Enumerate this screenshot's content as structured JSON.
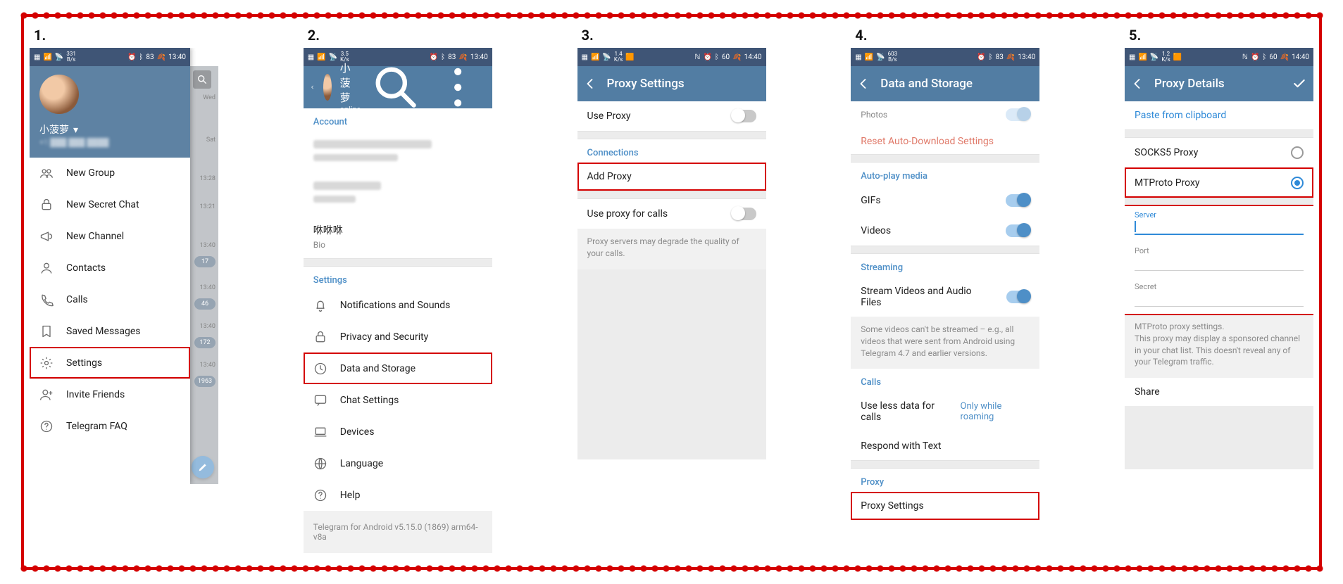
{
  "steps": {
    "s1": "1.",
    "s2": "2.",
    "s3": "3.",
    "s4": "4.",
    "s5": "5."
  },
  "step1": {
    "status": {
      "kbs": "331",
      "kbs_unit": "B/s",
      "battery": "83",
      "time": "13:40"
    },
    "drawer": {
      "username": "小菠萝",
      "items": {
        "new_group": "New Group",
        "new_secret_chat": "New Secret Chat",
        "new_channel": "New Channel",
        "contacts": "Contacts",
        "calls": "Calls",
        "saved_messages": "Saved Messages",
        "settings": "Settings",
        "invite_friends": "Invite Friends",
        "telegram_faq": "Telegram FAQ"
      }
    },
    "behind": {
      "day1": "Wed",
      "day2": "Sat",
      "t1": "13:28",
      "t2": "13:21",
      "t3": "13:40",
      "b1": "17",
      "t4": "13:40",
      "b2": "46",
      "t5": "13:40",
      "b3": "172",
      "t6": "13:40",
      "b4": "1963"
    }
  },
  "step2": {
    "status": {
      "kbs": "3.5",
      "kbs_unit": "K/s",
      "battery": "83",
      "time": "13:40"
    },
    "profile": {
      "name": "小菠萝",
      "status": "online"
    },
    "section_account": "Account",
    "bio_name": "咻咻咻",
    "bio_label": "Bio",
    "section_settings": "Settings",
    "items": {
      "notifications": "Notifications and Sounds",
      "privacy": "Privacy and Security",
      "data_storage": "Data and Storage",
      "chat_settings": "Chat Settings",
      "devices": "Devices",
      "language": "Language",
      "help": "Help"
    },
    "footer": "Telegram for Android v5.15.0 (1869) arm64-v8a"
  },
  "step3": {
    "status": {
      "kbs": "1.4",
      "kbs_unit": "K/s",
      "battery": "60",
      "time": "14:40"
    },
    "title": "Proxy Settings",
    "rows": {
      "use_proxy": "Use Proxy",
      "connections": "Connections",
      "add_proxy": "Add Proxy",
      "use_proxy_calls": "Use proxy for calls",
      "hint": "Proxy servers may degrade the quality of your calls."
    }
  },
  "step4": {
    "status": {
      "kbs": "603",
      "kbs_unit": "B/s",
      "battery": "83",
      "time": "13:40"
    },
    "title": "Data and Storage",
    "rows": {
      "photos": "Photos",
      "reset": "Reset Auto-Download Settings",
      "autoplay": "Auto-play media",
      "gifs": "GIFs",
      "videos": "Videos",
      "streaming": "Streaming",
      "stream_va": "Stream Videos and Audio Files",
      "stream_hint": "Some videos can't be streamed – e.g., all videos that were sent from Android using Telegram 4.7 and earlier versions.",
      "calls": "Calls",
      "less_data": "Use less data for calls",
      "less_data_val": "Only while roaming",
      "respond_text": "Respond with Text",
      "proxy": "Proxy",
      "proxy_settings": "Proxy Settings"
    }
  },
  "step5": {
    "status": {
      "kbs": "1.2",
      "kbs_unit": "K/s",
      "battery": "60",
      "time": "14:40"
    },
    "title": "Proxy Details",
    "rows": {
      "paste": "Paste from clipboard",
      "socks5": "SOCKS5 Proxy",
      "mtproto": "MTProto Proxy",
      "server": "Server",
      "port": "Port",
      "secret": "Secret",
      "hint_title": "MTProto proxy settings.",
      "hint_body": "This proxy may display a sponsored channel in your chat list. This doesn't reveal any of your Telegram traffic.",
      "share": "Share"
    }
  }
}
